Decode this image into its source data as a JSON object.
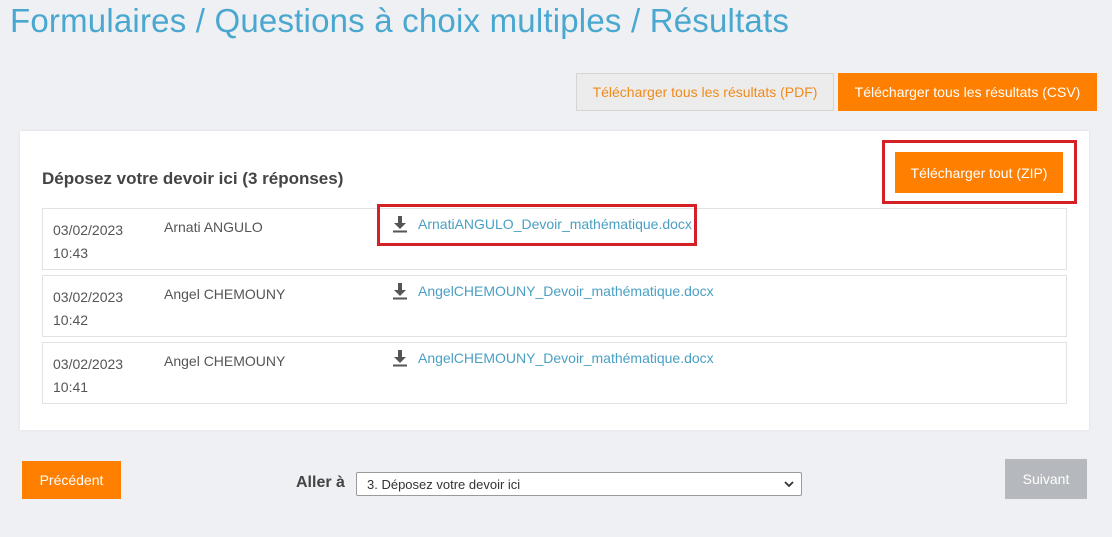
{
  "header": {
    "title": "Formulaires / Questions à choix multiples / Résultats"
  },
  "toolbar": {
    "pdf_label": "Télécharger tous les résultats (PDF)",
    "csv_label": "Télécharger tous les résultats (CSV)"
  },
  "card": {
    "title": "Déposez votre devoir ici (3 réponses)",
    "zip_label": "Télécharger tout (ZIP)",
    "rows": [
      {
        "date": "03/02/2023",
        "time": "10:43",
        "name": "Arnati ANGULO",
        "file": "ArnatiANGULO_Devoir_mathématique.docx"
      },
      {
        "date": "03/02/2023",
        "time": "10:42",
        "name": "Angel CHEMOUNY",
        "file": "AngelCHEMOUNY_Devoir_mathématique.docx"
      },
      {
        "date": "03/02/2023",
        "time": "10:41",
        "name": "Angel CHEMOUNY",
        "file": "AngelCHEMOUNY_Devoir_mathématique.docx"
      }
    ]
  },
  "footer": {
    "prev_label": "Précédent",
    "goto_label": "Aller à",
    "goto_selected": "3. Déposez votre devoir ici",
    "next_label": "Suivant"
  },
  "colors": {
    "accent": "#ff7f00",
    "title": "#4aa8d0",
    "link": "#4aa0c4",
    "highlight": "#d42027",
    "disabled": "#b5b8bc"
  },
  "icons": [
    "download-icon",
    "chevron-down-icon"
  ]
}
